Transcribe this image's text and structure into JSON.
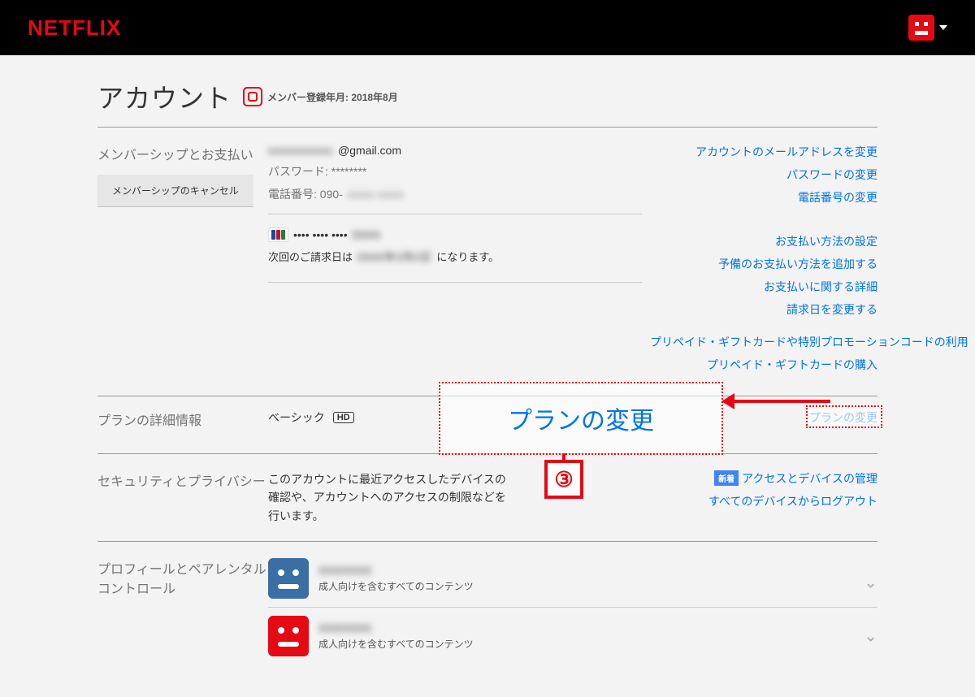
{
  "header": {
    "logo": "NETFLIX"
  },
  "page": {
    "title": "アカウント",
    "member_since": "メンバー登録年月: 2018年8月"
  },
  "membership": {
    "section_name": "メンバーシップとお支払い",
    "cancel_button": "メンバーシップのキャンセル",
    "email": "             @gmail.com",
    "password_label": "パスワード: ********",
    "phone_label": "電話番号: 090-",
    "links": {
      "change_email": "アカウントのメールアドレスを変更",
      "change_password": "パスワードの変更",
      "change_phone": "電話番号の変更"
    },
    "payment": {
      "card_masked": "•••• •••• ••••",
      "next_billing_pre": "次回のご請求日は",
      "next_billing_post": "になります。",
      "links": {
        "manage_payment": "お支払い方法の設定",
        "add_backup": "予備のお支払い方法を追加する",
        "billing_details": "お支払いに関する詳細",
        "change_billing_day": "請求日を変更する"
      }
    },
    "gift": {
      "redeem": "プリペイド・ギフトカードや特別プロモーションコードの利用",
      "buy": "プリペイド・ギフトカードの購入"
    }
  },
  "plan": {
    "section_name": "プランの詳細情報",
    "plan_name": "ベーシック",
    "hd_badge": "HD",
    "change_plan_link": "プランの変更"
  },
  "security": {
    "section_name": "セキュリティとプライバシー",
    "description": "このアカウントに最近アクセスしたデバイスの確認や、アカウントへのアクセスの制限などを行います。",
    "new_badge": "新着",
    "links": {
      "manage_access": "アクセスとデバイスの管理",
      "signout_all": "すべてのデバイスからログアウト"
    }
  },
  "profiles": {
    "section_name": "プロフィールとペアレンタルコントロール",
    "rows": [
      {
        "name": "XXXXXXX",
        "desc": "成人向けを含むすべてのコンテンツ"
      },
      {
        "name": "XXXXXXX",
        "desc": "成人向けを含むすべてのコンテンツ"
      }
    ]
  },
  "annotation": {
    "callout_text": "プランの変更",
    "step_number": "③"
  }
}
